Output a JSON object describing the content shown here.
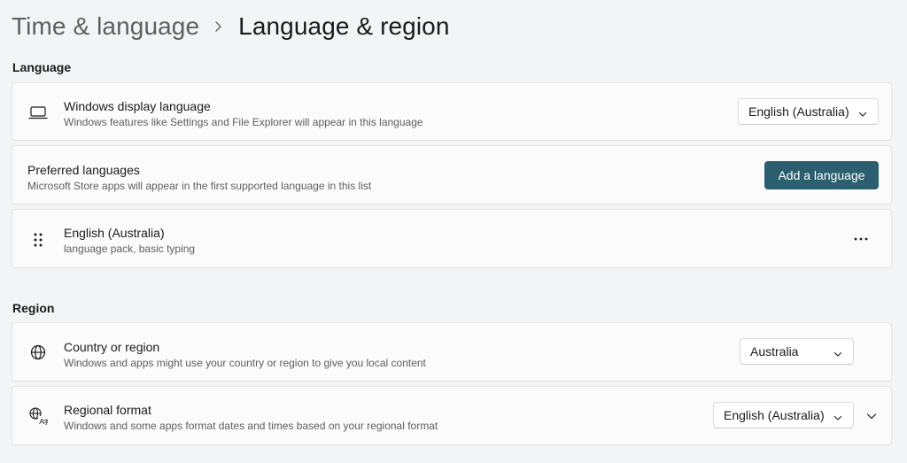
{
  "breadcrumb": {
    "parent": "Time & language",
    "current": "Language & region"
  },
  "language_section": {
    "heading": "Language",
    "display_language": {
      "icon": "laptop-icon",
      "title": "Windows display language",
      "description": "Windows features like Settings and File Explorer will appear in this language",
      "selected": "English (Australia)"
    },
    "preferred_languages": {
      "title": "Preferred languages",
      "description": "Microsoft Store apps will appear in the first supported language in this list",
      "button_label": "Add a language"
    },
    "installed_language": {
      "icon": "drag-handle-icon",
      "title": "English (Australia)",
      "description": "language pack, basic typing",
      "more_icon": "more-options-icon"
    }
  },
  "region_section": {
    "heading": "Region",
    "country": {
      "icon": "globe-icon",
      "title": "Country or region",
      "description": "Windows and apps might use your country or region to give you local content",
      "selected": "Australia"
    },
    "regional_format": {
      "icon": "regional-format-icon",
      "title": "Regional format",
      "description": "Windows and some apps format dates and times based on your regional format",
      "selected": "English (Australia)",
      "expand_icon": "chevron-down-icon"
    }
  },
  "colors": {
    "accent": "#2b5e6e",
    "background": "#f3f4f6",
    "card": "#fbfbfc"
  }
}
